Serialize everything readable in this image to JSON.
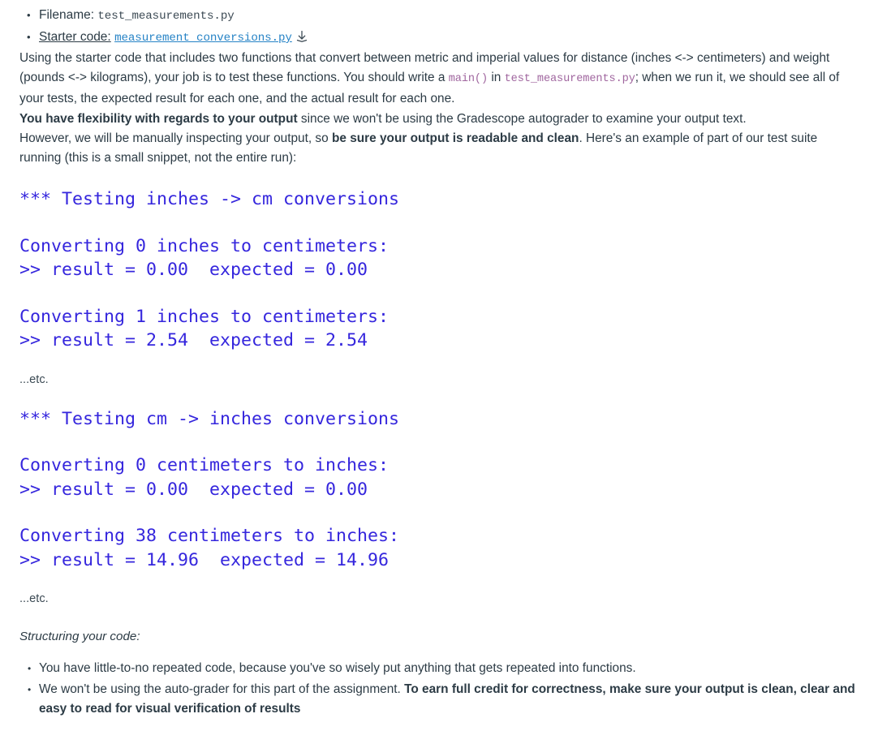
{
  "file_info": {
    "items": [
      {
        "label": "Filename:",
        "label_underlined": false,
        "value": "test_measurements.py",
        "is_link": false,
        "has_download_icon": false
      },
      {
        "label": "Starter code:",
        "label_underlined": true,
        "value": "measurement_conversions.py",
        "is_link": true,
        "has_download_icon": true,
        "download_icon_name": "download-icon"
      }
    ]
  },
  "intro": {
    "part1": "Using the starter code that includes two functions that convert between metric and imperial values for distance (inches <-> centimeters) and weight (pounds <-> kilograms), your job is to test these functions.  You should write a ",
    "code1": "main()",
    "part2": " in ",
    "code2": "test_measurements.py",
    "part3": "; when we run it, we should see all of your tests, the expected result for each one, and the actual result for each one."
  },
  "flexibility": {
    "bold1": "You have flexibility with regards to your output",
    "text1": " since we won't be using the Gradescope autograder to examine your output text.",
    "text2": "However, we will be manually inspecting your output, so ",
    "bold2": "be sure your output is readable and clean",
    "text3": ". Here's an example of part of our test suite running (this is a small snippet, not the entire run):"
  },
  "output_sample": {
    "section1": {
      "heading": "*** Testing inches -> cm conversions",
      "cases": [
        {
          "line1": "Converting 0 inches to centimeters:",
          "line2": ">> result = 0.00  expected = 0.00"
        },
        {
          "line1": "Converting 1 inches to centimeters:",
          "line2": ">> result = 2.54  expected = 2.54"
        }
      ],
      "etc": "...etc."
    },
    "section2": {
      "heading": "*** Testing cm -> inches conversions",
      "cases": [
        {
          "line1": "Converting 0 centimeters to inches:",
          "line2": ">> result = 0.00  expected = 0.00"
        },
        {
          "line1": "Converting 38 centimeters to inches:",
          "line2": ">> result = 14.96  expected = 14.96"
        }
      ],
      "etc": "...etc."
    }
  },
  "structuring": {
    "heading": "Structuring your code:",
    "bullets": [
      {
        "text": "You have little-to-no repeated code, because you've so wisely put anything that gets repeated into functions.",
        "bold": ""
      },
      {
        "text": "We won't be using the auto-grader for this part of the assignment. ",
        "bold": "To earn full credit for correctness, make sure your output is clean, clear and easy to read for visual verification of results"
      }
    ]
  },
  "colors": {
    "body_text": "#2c3b45",
    "link": "#2683c6",
    "inline_code": "#a0669f",
    "output_code": "#3526dd",
    "mono_dark": "#3c4a54"
  }
}
